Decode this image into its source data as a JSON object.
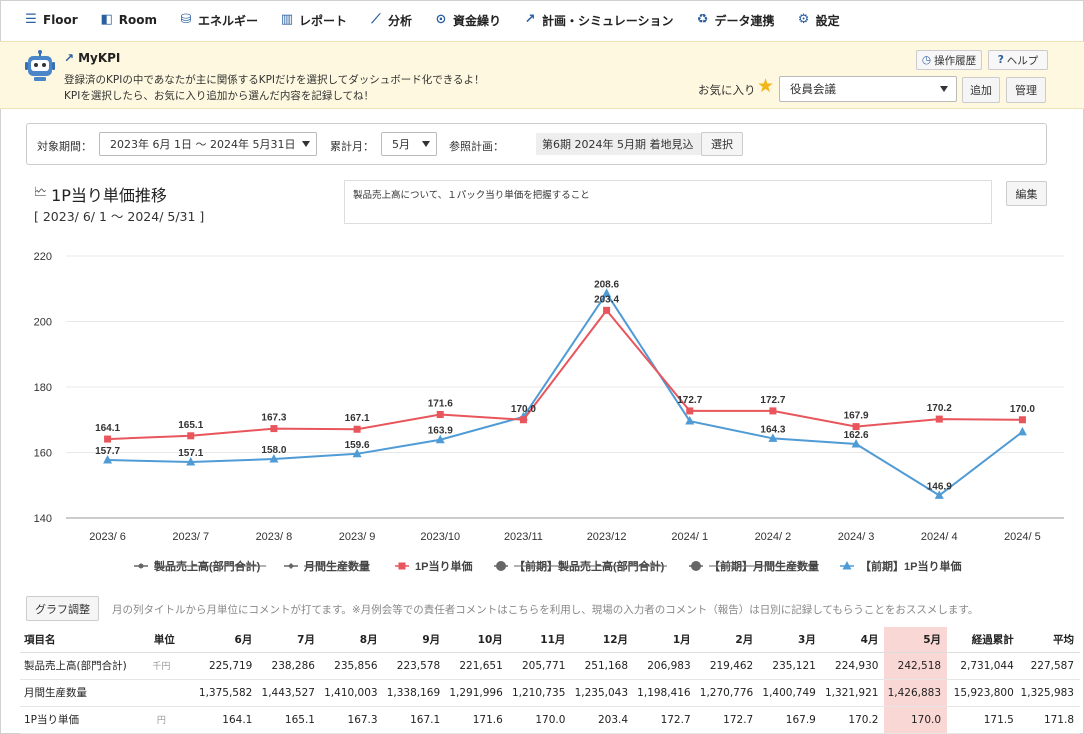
{
  "nav": {
    "items": [
      {
        "label": "Floor",
        "icon": "lines-icon"
      },
      {
        "label": "Room",
        "icon": "room-icon"
      },
      {
        "label": "エネルギー",
        "icon": "energy-icon"
      },
      {
        "label": "レポート",
        "icon": "bar-chart-icon"
      },
      {
        "label": "分析",
        "icon": "analysis-icon"
      },
      {
        "label": "資金繰り",
        "icon": "money-icon"
      },
      {
        "label": "計画・シミュレーション",
        "icon": "plan-icon"
      },
      {
        "label": "データ連携",
        "icon": "recycle-icon"
      },
      {
        "label": "設定",
        "icon": "gear-icon"
      }
    ]
  },
  "banner": {
    "title": "MyKPI",
    "line1": "登録済のKPIの中であなたが主に関係するKPIだけを選択してダッシュボード化できるよ！",
    "line2": "KPIを選択したら、お気に入り追加から選んだ内容を記録してね！",
    "history_label": "操作履歴",
    "help_label": "ヘルプ",
    "favorite_label": "お気に入り",
    "favorite_value": "役員会議",
    "add_label": "追加",
    "manage_label": "管理"
  },
  "filter": {
    "period_label": "対象期間：",
    "period_value": "2023年 6月 1日 ～ 2024年 5月31日",
    "month_label": "累計月：",
    "month_value": "5月",
    "plan_label": "参照計画：",
    "plan_value": "第6期 2024年 5月期 着地見込",
    "select_label": "選択"
  },
  "chart_header": {
    "title": "1P当り単価推移",
    "range": "[ 2023/ 6/ 1 ～ 2024/ 5/31 ]",
    "comment": "製品売上高について、１パック当り単価を把握すること",
    "edit_label": "編集"
  },
  "colors": {
    "current": "#e8555a",
    "previous": "#4f9bd6",
    "grid": "#e8e8e8",
    "highlight": "#f9d7d5"
  },
  "chart_data": {
    "type": "line",
    "categories": [
      "2023/ 6",
      "2023/ 7",
      "2023/ 8",
      "2023/ 9",
      "2023/10",
      "2023/11",
      "2023/12",
      "2024/ 1",
      "2024/ 2",
      "2024/ 3",
      "2024/ 4",
      "2024/ 5"
    ],
    "ylim": [
      140,
      220
    ],
    "yticks": [
      140,
      160,
      180,
      200,
      220
    ],
    "grid": true,
    "legend_placement": "bottom",
    "series": [
      {
        "name": "1P当り単価",
        "values": [
          164.1,
          165.1,
          167.3,
          167.1,
          171.6,
          170.0,
          203.4,
          172.7,
          172.7,
          167.9,
          170.2,
          170.0
        ],
        "labels": [
          "164.1",
          "165.1",
          "167.3",
          "167.1",
          "171.6",
          "170.0",
          "203.4",
          "172.7",
          "172.7",
          "167.9",
          "170.2",
          "170.0"
        ],
        "color": "#e8555a",
        "marker": "square"
      },
      {
        "name": "【前期】1P当り単価",
        "values": [
          157.7,
          157.1,
          158.0,
          159.6,
          163.9,
          170.9,
          208.6,
          169.6,
          164.3,
          162.6,
          146.9,
          166.3
        ],
        "labels": [
          "157.7",
          "157.1",
          "158.0",
          "159.6",
          "163.9",
          "",
          "208.6",
          "",
          "164.3",
          "162.6",
          "146.9",
          ""
        ],
        "color": "#4f9bd6",
        "marker": "triangle"
      }
    ],
    "legend": [
      {
        "label": "製品売上高(部門合計)",
        "marker": "dot",
        "color": "#666",
        "struck": true
      },
      {
        "label": "月間生産数量",
        "marker": "diamond",
        "color": "#666",
        "struck": true
      },
      {
        "label": "1P当り単価",
        "marker": "square",
        "color": "#e8555a",
        "struck": false
      },
      {
        "label": "【前期】製品売上高(部門合計)",
        "marker": "bigdot",
        "color": "#666",
        "struck": true
      },
      {
        "label": "【前期】月間生産数量",
        "marker": "bigdot",
        "color": "#666",
        "struck": true
      },
      {
        "label": "【前期】1P当り単価",
        "marker": "triangle",
        "color": "#4f9bd6",
        "struck": false
      }
    ]
  },
  "graph_tools": {
    "adjust_label": "グラフ調整",
    "note": "月の列タイトルから月単位にコメントが打てます。※月例会等での責任者コメントはこちらを利用し、現場の入力者のコメント（報告）は日別に記録してもらうことをおススメします。"
  },
  "table": {
    "headers": [
      "項目名",
      "単位",
      "6月",
      "7月",
      "8月",
      "9月",
      "10月",
      "11月",
      "12月",
      "1月",
      "2月",
      "3月",
      "4月",
      "5月",
      "経過累計",
      "平均"
    ],
    "rows": [
      {
        "name": "製品売上高(部門合計)",
        "unit": "千円",
        "values": [
          "225,719",
          "238,286",
          "235,856",
          "223,578",
          "221,651",
          "205,771",
          "251,168",
          "206,983",
          "219,462",
          "235,121",
          "224,930",
          "242,518",
          "2,731,044",
          "227,587"
        ]
      },
      {
        "name": "月間生産数量",
        "unit": "",
        "values": [
          "1,375,582",
          "1,443,527",
          "1,410,003",
          "1,338,169",
          "1,291,996",
          "1,210,735",
          "1,235,043",
          "1,198,416",
          "1,270,776",
          "1,400,749",
          "1,321,921",
          "1,426,883",
          "15,923,800",
          "1,325,983"
        ]
      },
      {
        "name": "1P当り単価",
        "unit": "円",
        "values": [
          "164.1",
          "165.1",
          "167.3",
          "167.1",
          "171.6",
          "170.0",
          "203.4",
          "172.7",
          "172.7",
          "167.9",
          "170.2",
          "170.0",
          "171.5",
          "171.8"
        ]
      }
    ]
  }
}
